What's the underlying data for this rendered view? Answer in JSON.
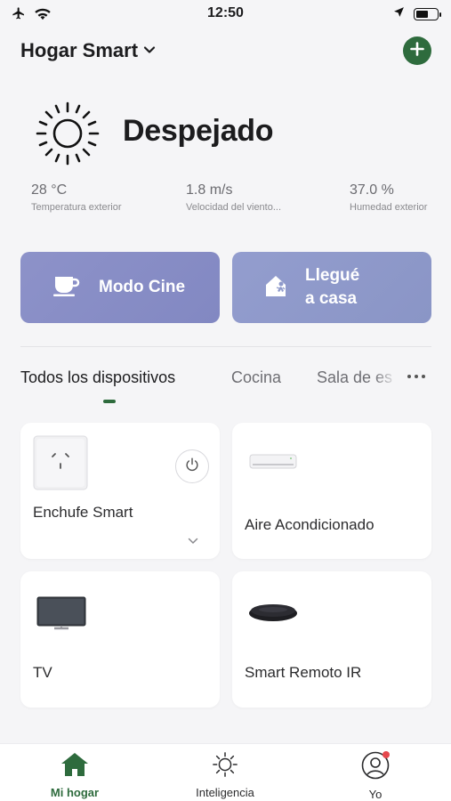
{
  "status_bar": {
    "time": "12:50",
    "battery_level": 0.6
  },
  "header": {
    "home_name": "Hogar Smart"
  },
  "weather": {
    "condition": "Despejado",
    "metrics": [
      {
        "value": "28 °C",
        "label": "Temperatura exterior"
      },
      {
        "value": "1.8 m/s",
        "label": "Velocidad del viento..."
      },
      {
        "value": "37.0 %",
        "label": "Humedad exterior"
      }
    ]
  },
  "scenes": [
    {
      "label": "Modo Cine",
      "icon": "coffee-cup-icon",
      "color": "#8a90c9"
    },
    {
      "label_line1": "Llegué",
      "label_line2": "a casa",
      "icon": "home-person-icon",
      "color": "#8f9acb"
    }
  ],
  "tabs": [
    {
      "label": "Todos los dispositivos",
      "active": true
    },
    {
      "label": "Cocina",
      "active": false
    },
    {
      "label": "Sala de es",
      "active": false
    }
  ],
  "devices": [
    {
      "name": "Enchufe Smart",
      "icon": "power-outlet-icon"
    },
    {
      "name": "Aire Acondicionado",
      "icon": "air-conditioner-icon"
    },
    {
      "name": "TV",
      "icon": "tv-icon"
    },
    {
      "name": "Smart Remoto IR",
      "icon": "ir-remote-hub-icon"
    }
  ],
  "bottom_nav": [
    {
      "label": "Mi hogar",
      "icon": "home-icon",
      "active": true
    },
    {
      "label": "Inteligencia",
      "icon": "sun-icon",
      "active": false
    },
    {
      "label": "Yo",
      "icon": "user-icon",
      "active": false,
      "notification": true
    }
  ],
  "colors": {
    "accent": "#2e6b3d",
    "background": "#f5f5f7",
    "notification": "#e5484d"
  }
}
